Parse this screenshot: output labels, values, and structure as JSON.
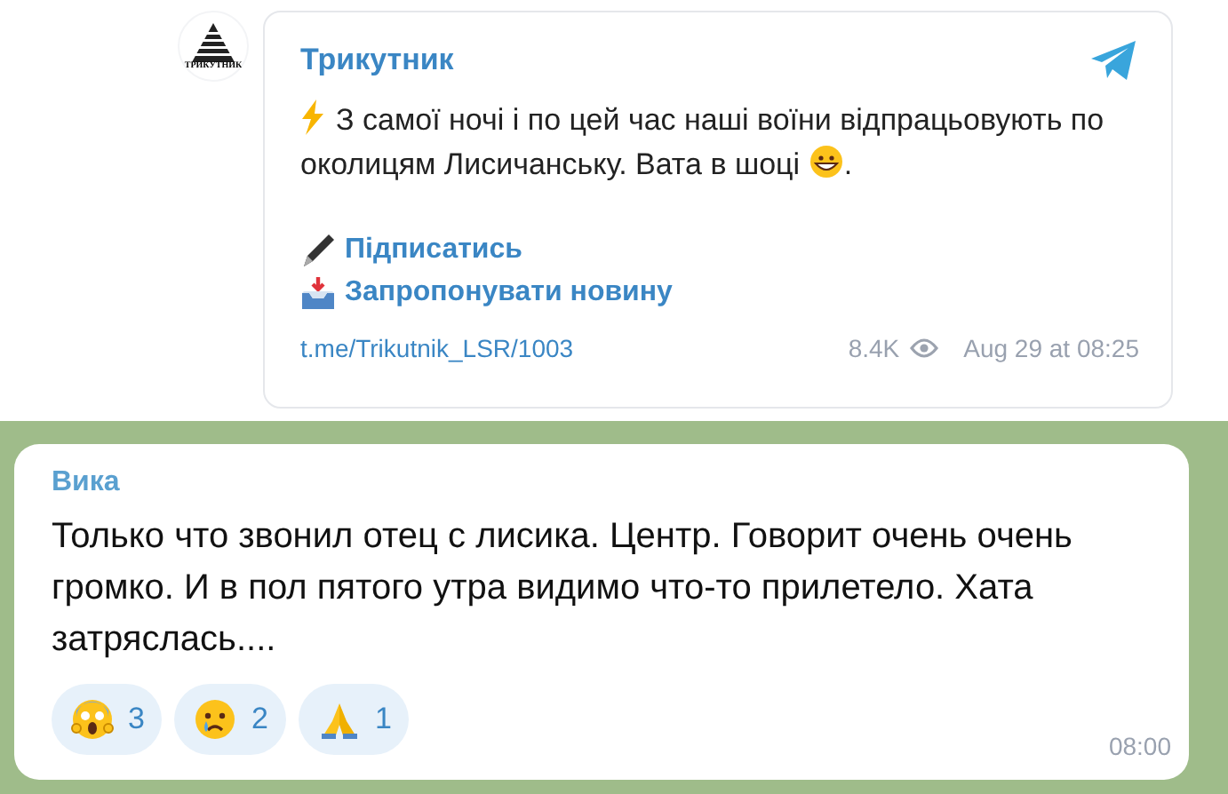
{
  "post": {
    "logo_text": "ТРИКУТНИК",
    "channel": "Трикутник",
    "text": "З самої ночі і по цей час наші воїни відпрацьовують по околицям Лисичанську. Вата в шоці",
    "text_end": ".",
    "links": [
      {
        "kind": "pen",
        "label": "Підписатись"
      },
      {
        "kind": "inbox",
        "label": "Запропонувати новину"
      }
    ],
    "url": "t.me/Trikutnik_LSR/1003",
    "views": "8.4K",
    "date": "Aug 29 at 08:25"
  },
  "message": {
    "author": "Вика",
    "text": "Только что звонил отец с лисика. Центр. Говорит очень очень громко. И в пол пятого утра видимо что-то прилетело. Хата затряслась....",
    "reactions": [
      {
        "kind": "scream",
        "count": "3"
      },
      {
        "kind": "cry",
        "count": "2"
      },
      {
        "kind": "pray",
        "count": "1"
      }
    ],
    "time": "08:00"
  }
}
